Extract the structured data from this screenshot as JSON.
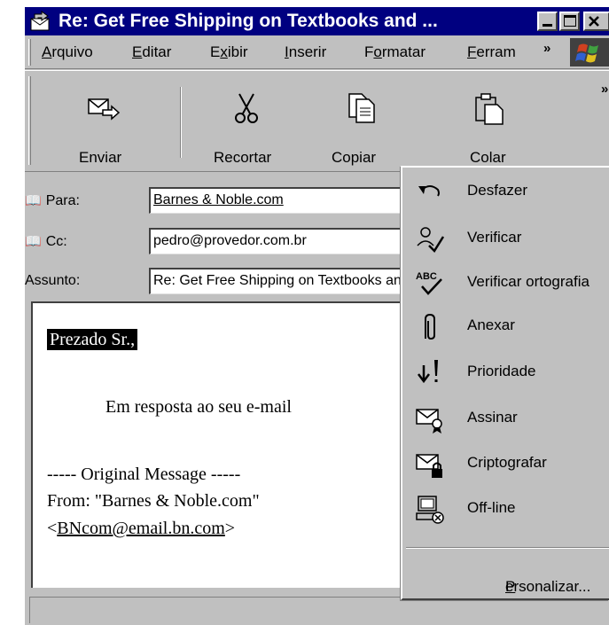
{
  "window": {
    "title": "Re: Get Free Shipping on Textbooks and ..."
  },
  "menu": {
    "items": [
      {
        "pre": "",
        "key": "A",
        "post": "rquivo"
      },
      {
        "pre": "",
        "key": "E",
        "post": "ditar"
      },
      {
        "pre": "E",
        "key": "x",
        "post": "ibir"
      },
      {
        "pre": "",
        "key": "I",
        "post": "nserir"
      },
      {
        "pre": "F",
        "key": "o",
        "post": "rmatar"
      },
      {
        "pre": "",
        "key": "F",
        "post": "erram"
      }
    ],
    "chevron": "»"
  },
  "toolbar": {
    "buttons": [
      {
        "label": "Enviar",
        "icon": "send-icon"
      },
      {
        "label": "Recortar",
        "icon": "scissors-icon"
      },
      {
        "label": "Copiar",
        "icon": "copy-icon"
      },
      {
        "label": "Colar",
        "icon": "paste-icon"
      }
    ],
    "chevron": "»"
  },
  "header": {
    "to_label": "Para:",
    "to_value": "Barnes & Noble.com",
    "cc_label": "Cc:",
    "cc_value": "pedro@provedor.com.br",
    "subject_label": "Assunto:",
    "subject_value": "Re: Get Free Shipping on Textbooks and More"
  },
  "body": {
    "greeting": "Prezado Sr.,",
    "reply": "Em resposta ao seu e-mail",
    "original_marker": "----- Original Message -----",
    "from_line": "From: \"Barnes & Noble.com\"",
    "email_open": "<",
    "email": "BNcom@email.bn.com",
    "email_close": ">"
  },
  "popup_menu": {
    "items": [
      {
        "label": "Desfazer",
        "icon": "undo-icon"
      },
      {
        "label": "Verificar",
        "icon": "check-names-icon"
      },
      {
        "label": "Verificar ortografia",
        "icon": "spelling-icon"
      },
      {
        "label": "Anexar",
        "icon": "paperclip-icon"
      },
      {
        "label": "Prioridade",
        "icon": "priority-icon"
      },
      {
        "label": "Assinar",
        "icon": "sign-icon"
      },
      {
        "label": "Criptografar",
        "icon": "encrypt-icon"
      },
      {
        "label": "Off-line",
        "icon": "offline-icon"
      }
    ],
    "customize": {
      "key": "P",
      "rest": "ersonalizar..."
    }
  }
}
